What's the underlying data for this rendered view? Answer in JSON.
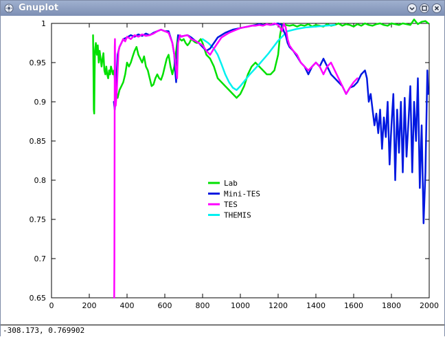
{
  "window": {
    "title": "Gnuplot",
    "app_icon": "gnuplot-icon",
    "controls": [
      "minimize",
      "maximize",
      "close"
    ]
  },
  "status": {
    "coords": "-308.173,  0.769902"
  },
  "chart_data": {
    "type": "line",
    "title": "",
    "xlabel": "",
    "ylabel": "",
    "xlim": [
      0,
      2000
    ],
    "ylim": [
      0.65,
      1.0
    ],
    "grid": false,
    "legend_position": "center",
    "x_ticks": [
      0,
      200,
      400,
      600,
      800,
      1000,
      1200,
      1400,
      1600,
      1800,
      2000
    ],
    "y_ticks": [
      0.65,
      0.7,
      0.75,
      0.8,
      0.85,
      0.9,
      0.95,
      1.0
    ],
    "y_tick_labels": [
      "0.65",
      "0.7",
      "0.75",
      "0.8",
      "0.85",
      "0.9",
      "0.95",
      "1"
    ],
    "series": [
      {
        "name": "Lab",
        "color": "#00e000",
        "x": [
          220,
          222,
          224,
          226,
          228,
          230,
          235,
          240,
          245,
          250,
          255,
          260,
          265,
          270,
          275,
          280,
          285,
          290,
          295,
          300,
          305,
          310,
          315,
          320,
          325,
          330,
          335,
          340,
          345,
          350,
          355,
          360,
          370,
          380,
          390,
          400,
          410,
          420,
          430,
          440,
          450,
          460,
          470,
          480,
          490,
          500,
          510,
          520,
          530,
          540,
          550,
          560,
          570,
          580,
          590,
          600,
          610,
          620,
          630,
          640,
          650,
          660,
          670,
          680,
          690,
          700,
          710,
          720,
          730,
          740,
          750,
          760,
          770,
          780,
          790,
          800,
          820,
          840,
          860,
          880,
          900,
          920,
          940,
          960,
          980,
          1000,
          1020,
          1040,
          1060,
          1080,
          1100,
          1120,
          1140,
          1160,
          1180,
          1200,
          1210,
          1220,
          1230,
          1240,
          1260,
          1280,
          1300,
          1320,
          1340,
          1360,
          1380,
          1400,
          1420,
          1440,
          1460,
          1480,
          1500,
          1520,
          1540,
          1560,
          1580,
          1600,
          1620,
          1640,
          1660,
          1680,
          1700,
          1720,
          1740,
          1760,
          1780,
          1800,
          1820,
          1840,
          1860,
          1880,
          1900,
          1920,
          1940,
          1960,
          1980,
          1995
        ],
        "y": [
          0.985,
          0.94,
          0.89,
          0.885,
          0.93,
          0.965,
          0.975,
          0.96,
          0.972,
          0.95,
          0.965,
          0.955,
          0.945,
          0.955,
          0.962,
          0.94,
          0.935,
          0.945,
          0.935,
          0.93,
          0.94,
          0.935,
          0.945,
          0.94,
          0.935,
          0.94,
          0.93,
          0.925,
          0.91,
          0.905,
          0.91,
          0.915,
          0.92,
          0.925,
          0.935,
          0.95,
          0.945,
          0.95,
          0.958,
          0.965,
          0.97,
          0.96,
          0.955,
          0.95,
          0.958,
          0.945,
          0.94,
          0.93,
          0.92,
          0.922,
          0.93,
          0.935,
          0.93,
          0.928,
          0.935,
          0.945,
          0.955,
          0.96,
          0.945,
          0.935,
          0.945,
          0.965,
          0.985,
          0.98,
          0.978,
          0.98,
          0.975,
          0.972,
          0.975,
          0.98,
          0.978,
          0.976,
          0.975,
          0.977,
          0.98,
          0.975,
          0.96,
          0.955,
          0.945,
          0.93,
          0.925,
          0.92,
          0.915,
          0.91,
          0.905,
          0.91,
          0.92,
          0.935,
          0.945,
          0.95,
          0.945,
          0.94,
          0.935,
          0.935,
          0.94,
          0.96,
          0.985,
          0.998,
          1.0,
          0.998,
          0.997,
          0.998,
          0.996,
          0.998,
          0.997,
          0.999,
          0.996,
          0.998,
          0.997,
          0.996,
          0.999,
          0.997,
          0.998,
          1.0,
          0.997,
          0.999,
          0.998,
          0.996,
          0.999,
          0.997,
          1.0,
          0.998,
          0.997,
          0.999,
          1.0,
          0.998,
          0.997,
          1.0,
          0.999,
          0.998,
          1.0,
          0.999,
          0.998,
          1.005,
          0.999,
          1.002,
          1.003,
          1.0
        ]
      },
      {
        "name": "Mini-TES",
        "color": "#0018e0",
        "x": [
          330,
          335,
          340,
          345,
          350,
          360,
          370,
          380,
          400,
          420,
          440,
          460,
          480,
          500,
          520,
          540,
          560,
          580,
          600,
          620,
          640,
          650,
          655,
          660,
          665,
          670,
          680,
          700,
          720,
          740,
          760,
          780,
          800,
          820,
          840,
          860,
          880,
          900,
          920,
          940,
          960,
          980,
          1000,
          1020,
          1040,
          1060,
          1080,
          1100,
          1120,
          1140,
          1160,
          1180,
          1200,
          1220,
          1230,
          1240,
          1250,
          1260,
          1280,
          1300,
          1320,
          1340,
          1360,
          1380,
          1400,
          1420,
          1440,
          1460,
          1480,
          1500,
          1520,
          1540,
          1560,
          1580,
          1600,
          1620,
          1640,
          1660,
          1670,
          1680,
          1690,
          1700,
          1710,
          1720,
          1730,
          1740,
          1750,
          1760,
          1770,
          1780,
          1790,
          1800,
          1810,
          1820,
          1830,
          1840,
          1850,
          1860,
          1870,
          1880,
          1890,
          1900,
          1910,
          1920,
          1930,
          1940,
          1950,
          1960,
          1970,
          1980,
          1990,
          1995
        ],
        "y": [
          0.9,
          0.89,
          0.91,
          0.935,
          0.96,
          0.97,
          0.975,
          0.98,
          0.982,
          0.985,
          0.983,
          0.986,
          0.984,
          0.987,
          0.985,
          0.988,
          0.99,
          0.992,
          0.99,
          0.99,
          0.975,
          0.96,
          0.94,
          0.925,
          0.96,
          0.985,
          0.983,
          0.984,
          0.985,
          0.982,
          0.978,
          0.975,
          0.97,
          0.965,
          0.968,
          0.975,
          0.982,
          0.985,
          0.988,
          0.99,
          0.992,
          0.993,
          0.994,
          0.995,
          0.996,
          0.997,
          0.998,
          0.999,
          0.998,
          0.999,
          0.998,
          0.999,
          1.0,
          0.998,
          0.99,
          0.985,
          0.975,
          0.97,
          0.965,
          0.958,
          0.95,
          0.945,
          0.935,
          0.945,
          0.95,
          0.945,
          0.955,
          0.945,
          0.935,
          0.93,
          0.925,
          0.92,
          0.91,
          0.918,
          0.92,
          0.925,
          0.935,
          0.94,
          0.93,
          0.9,
          0.91,
          0.89,
          0.87,
          0.885,
          0.86,
          0.89,
          0.84,
          0.88,
          0.855,
          0.9,
          0.82,
          0.87,
          0.91,
          0.8,
          0.89,
          0.835,
          0.9,
          0.81,
          0.905,
          0.83,
          0.875,
          0.92,
          0.81,
          0.9,
          0.85,
          0.93,
          0.79,
          0.87,
          0.745,
          0.81,
          0.94,
          0.91
        ],
        "xerr": []
      },
      {
        "name": "TES",
        "color": "#ff00ff",
        "x": [
          332,
          333,
          334,
          335,
          336,
          337,
          338,
          340,
          345,
          350,
          355,
          360,
          370,
          380,
          390,
          400,
          420,
          440,
          460,
          480,
          500,
          520,
          540,
          560,
          580,
          600,
          620,
          640,
          650,
          660,
          665,
          670,
          680,
          690,
          700,
          720,
          740,
          760,
          780,
          800,
          820,
          840,
          860,
          880,
          900,
          920,
          940,
          960,
          980,
          1000,
          1020,
          1040,
          1060,
          1080,
          1100,
          1120,
          1140,
          1160,
          1180,
          1200,
          1210,
          1220,
          1230,
          1240,
          1250,
          1260,
          1280,
          1300,
          1320,
          1340,
          1360,
          1380,
          1400,
          1420,
          1440,
          1460,
          1480,
          1500,
          1520,
          1540,
          1560,
          1580,
          1600,
          1620
        ],
        "y": [
          0.65,
          0.7,
          0.85,
          0.97,
          0.98,
          0.93,
          0.9,
          0.895,
          0.91,
          0.94,
          0.965,
          0.97,
          0.975,
          0.98,
          0.977,
          0.983,
          0.98,
          0.985,
          0.983,
          0.986,
          0.984,
          0.985,
          0.987,
          0.99,
          0.992,
          0.99,
          0.988,
          0.975,
          0.96,
          0.94,
          0.93,
          0.975,
          0.985,
          0.983,
          0.984,
          0.985,
          0.98,
          0.978,
          0.975,
          0.972,
          0.965,
          0.96,
          0.968,
          0.975,
          0.982,
          0.985,
          0.988,
          0.99,
          0.992,
          0.994,
          0.995,
          0.996,
          0.997,
          0.997,
          0.998,
          0.997,
          0.999,
          0.998,
          1.0,
          0.998,
          0.995,
          0.99,
          1.0,
          0.995,
          0.98,
          0.972,
          0.965,
          0.96,
          0.95,
          0.945,
          0.94,
          0.945,
          0.95,
          0.945,
          0.935,
          0.945,
          0.95,
          0.94,
          0.93,
          0.92,
          0.91,
          0.918,
          0.925,
          0.93
        ]
      },
      {
        "name": "THEMIS",
        "color": "#00f0f0",
        "x": [
          800,
          830,
          860,
          880,
          900,
          920,
          940,
          960,
          980,
          1000,
          1050,
          1100,
          1150,
          1200,
          1250,
          1300,
          1350,
          1400,
          1450,
          1500
        ],
        "y": [
          0.98,
          0.975,
          0.968,
          0.96,
          0.948,
          0.935,
          0.925,
          0.918,
          0.915,
          0.92,
          0.935,
          0.948,
          0.962,
          0.978,
          0.99,
          0.993,
          0.995,
          0.996,
          0.997,
          0.998
        ]
      }
    ]
  }
}
